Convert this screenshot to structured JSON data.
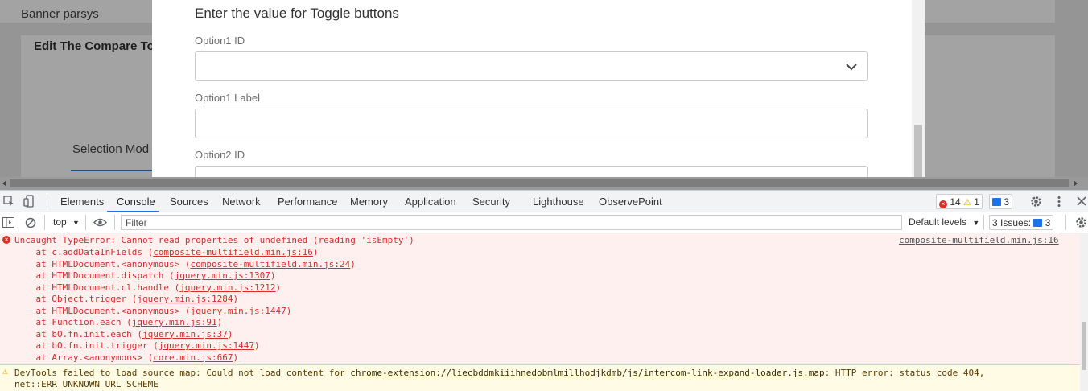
{
  "background": {
    "banner_label": "Banner parsys",
    "edit_label": "Edit The Compare To",
    "selection_label": "Selection Mod"
  },
  "dialog": {
    "title": "Enter the value for Toggle buttons",
    "fields": [
      {
        "label": "Option1 ID",
        "type": "select",
        "value": ""
      },
      {
        "label": "Option1 Label",
        "type": "text",
        "value": ""
      },
      {
        "label": "Option2 ID",
        "type": "select",
        "value": ""
      }
    ]
  },
  "devtools": {
    "tabs": [
      "Elements",
      "Console",
      "Sources",
      "Network",
      "Performance",
      "Memory",
      "Application",
      "Security",
      "Lighthouse",
      "ObservePoint"
    ],
    "active_tab": "Console",
    "error_count": "14",
    "warning_count": "1",
    "message_count": "3",
    "context": "top",
    "filter_placeholder": "Filter",
    "levels_label": "Default levels",
    "issues_label": "3 Issues:",
    "issues_count": "3"
  },
  "console": {
    "error": {
      "message": "Uncaught TypeError: Cannot read properties of undefined (reading 'isEmpty')",
      "source": "composite-multifield.min.js:16",
      "stack": [
        {
          "prefix": "    at c.addDataInFields (",
          "link": "composite-multifield.min.js:16",
          "suffix": ")"
        },
        {
          "prefix": "    at HTMLDocument.<anonymous> (",
          "link": "composite-multifield.min.js:24",
          "suffix": ")"
        },
        {
          "prefix": "    at HTMLDocument.dispatch (",
          "link": "jquery.min.js:1307",
          "suffix": ")"
        },
        {
          "prefix": "    at HTMLDocument.cl.handle (",
          "link": "jquery.min.js:1212",
          "suffix": ")"
        },
        {
          "prefix": "    at Object.trigger (",
          "link": "jquery.min.js:1284",
          "suffix": ")"
        },
        {
          "prefix": "    at HTMLDocument.<anonymous> (",
          "link": "jquery.min.js:1447",
          "suffix": ")"
        },
        {
          "prefix": "    at Function.each (",
          "link": "jquery.min.js:91",
          "suffix": ")"
        },
        {
          "prefix": "    at bO.fn.init.each (",
          "link": "jquery.min.js:37",
          "suffix": ")"
        },
        {
          "prefix": "    at bO.fn.init.trigger (",
          "link": "jquery.min.js:1447",
          "suffix": ")"
        },
        {
          "prefix": "    at Array.<anonymous> (",
          "link": "core.min.js:667",
          "suffix": ")"
        }
      ]
    },
    "warning": {
      "prefix": "DevTools failed to load source map: Could not load content for ",
      "link": "chrome-extension://liecbddmkiiihnedobmlmillhodjkdmb/js/intercom-link-expand-loader.js.map",
      "suffix": ": HTTP error: status code 404,",
      "line2": "net::ERR_UNKNOWN_URL_SCHEME"
    }
  },
  "colors": {
    "error_text": "#d32f2f",
    "error_bg": "#fff0f0",
    "warning_bg": "#fffbe5",
    "accent": "#1a73e8"
  }
}
